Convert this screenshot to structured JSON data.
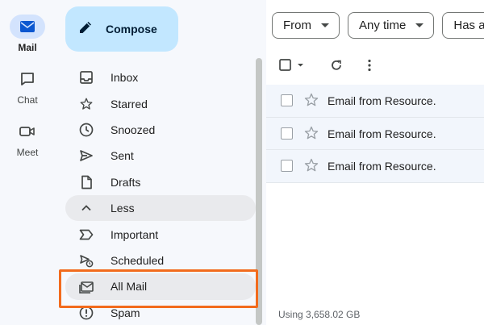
{
  "rail": {
    "items": [
      {
        "label": "Mail",
        "icon": "mail-icon",
        "active": true
      },
      {
        "label": "Chat",
        "icon": "chat-icon",
        "active": false
      },
      {
        "label": "Meet",
        "icon": "meet-icon",
        "active": false
      }
    ]
  },
  "compose": {
    "label": "Compose",
    "icon": "pencil-icon"
  },
  "nav": {
    "items": [
      {
        "label": "Inbox",
        "icon": "inbox-icon"
      },
      {
        "label": "Starred",
        "icon": "star-icon"
      },
      {
        "label": "Snoozed",
        "icon": "clock-icon"
      },
      {
        "label": "Sent",
        "icon": "send-icon"
      },
      {
        "label": "Drafts",
        "icon": "draft-icon"
      },
      {
        "label": "Less",
        "icon": "chevron-up-icon"
      },
      {
        "label": "Important",
        "icon": "important-icon"
      },
      {
        "label": "Scheduled",
        "icon": "scheduled-icon"
      },
      {
        "label": "All Mail",
        "icon": "all-mail-icon"
      },
      {
        "label": "Spam",
        "icon": "spam-icon"
      }
    ]
  },
  "filters": {
    "from": "From",
    "time": "Any time",
    "has": "Has a"
  },
  "emails": [
    {
      "subject": "Email from Resource."
    },
    {
      "subject": "Email from Resource."
    },
    {
      "subject": "Email from Resource."
    }
  ],
  "storage": "Using 3,658.02 GB",
  "colors": {
    "accent": "#c2e7ff",
    "highlight": "#f26b1d",
    "active_rail": "#d3e3fd"
  }
}
